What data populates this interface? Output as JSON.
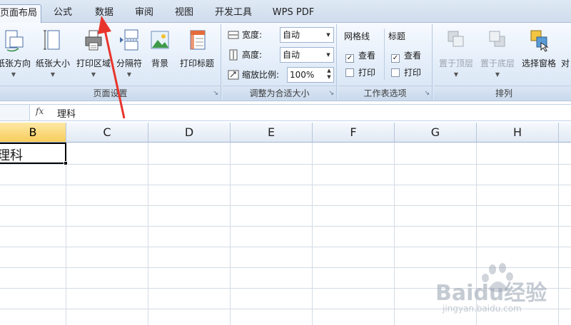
{
  "tabs": [
    {
      "label": "页面布局",
      "active": true
    },
    {
      "label": "公式",
      "active": false
    },
    {
      "label": "数据",
      "active": false
    },
    {
      "label": "审阅",
      "active": false
    },
    {
      "label": "视图",
      "active": false
    },
    {
      "label": "开发工具",
      "active": false
    },
    {
      "label": "WPS PDF",
      "active": false
    }
  ],
  "page_setup": {
    "title": "页面设置",
    "buttons": [
      "纸张方向",
      "纸张大小",
      "打印区域",
      "分隔符",
      "背景",
      "打印标题"
    ]
  },
  "scale_to_fit": {
    "title": "调整为合适大小",
    "width_label": "宽度:",
    "width_value": "自动",
    "height_label": "高度:",
    "height_value": "自动",
    "scale_label": "缩放比例:",
    "scale_value": "100%"
  },
  "sheet_options": {
    "title": "工作表选项",
    "gridlines_title": "网格线",
    "headings_title": "标题",
    "view_label": "查看",
    "print_label": "打印",
    "gridlines_view": true,
    "gridlines_print": false,
    "headings_view": true,
    "headings_print": false
  },
  "arrange": {
    "title": "排列",
    "buttons": [
      "置于顶层",
      "置于底层",
      "选择窗格",
      "对"
    ]
  },
  "formula_bar": {
    "fx": "fx",
    "content": "理科"
  },
  "columns": [
    "B",
    "C",
    "D",
    "E",
    "F",
    "G",
    "H"
  ],
  "selected_column": "B",
  "active_cell": {
    "ref": "B1",
    "value": "理科"
  },
  "watermark": {
    "brand": "Baidu经验",
    "url": "jingyan.baidu.com"
  },
  "colors": {
    "accent": "#f7cc5a",
    "arrow": "#e8352c",
    "ribbon": "#dfe9f5"
  }
}
